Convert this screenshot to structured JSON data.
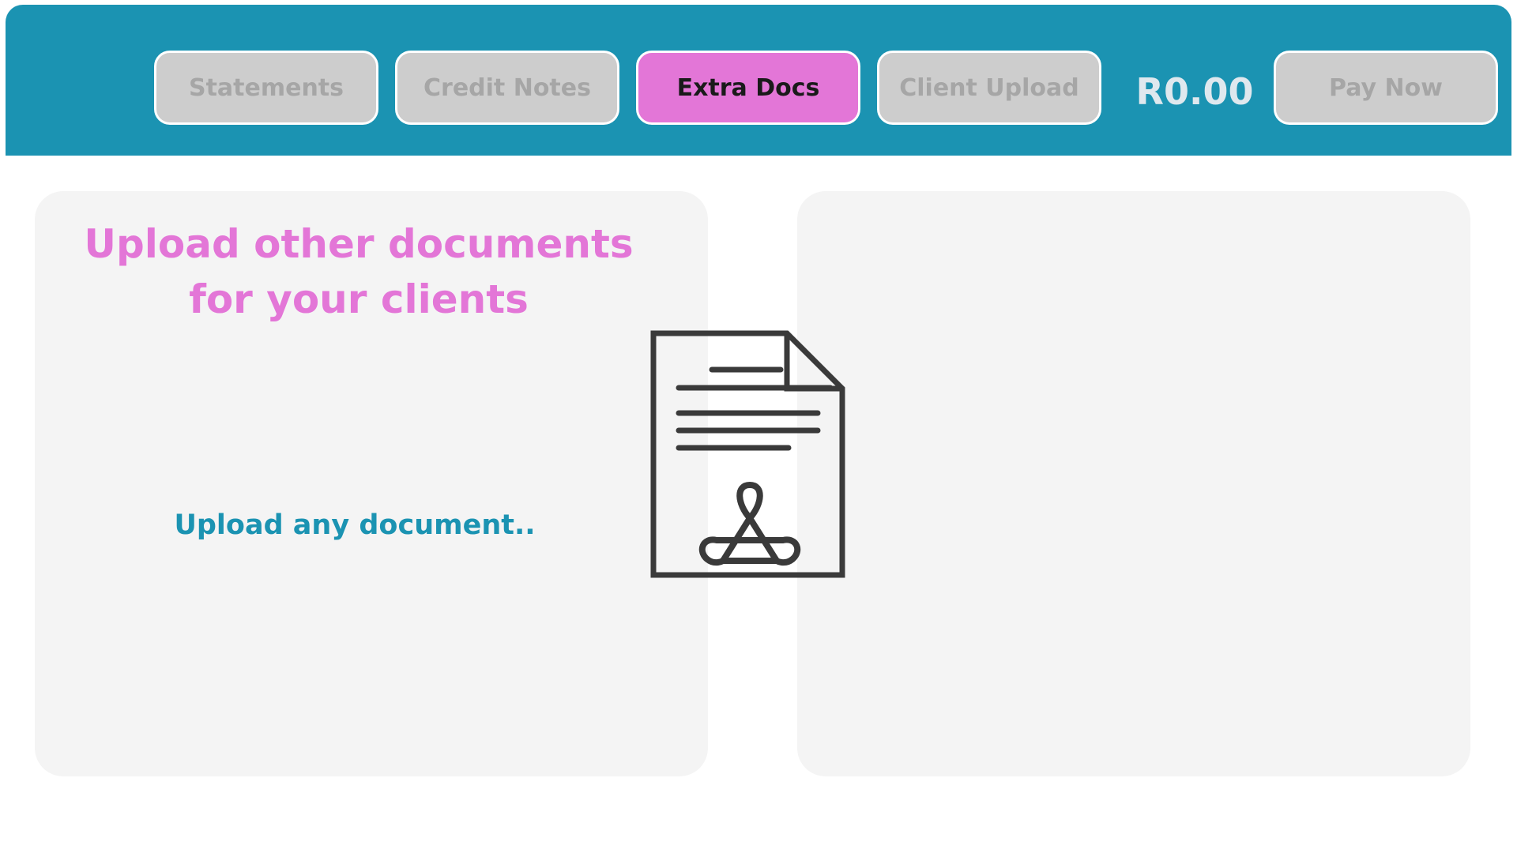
{
  "header": {
    "tabs": [
      {
        "label": "Statements",
        "active": false
      },
      {
        "label": "Credit Notes",
        "active": false
      },
      {
        "label": "Extra Docs",
        "active": true
      },
      {
        "label": "Client Upload",
        "active": false
      }
    ],
    "balance": "R0.00",
    "pay_now_label": "Pay Now"
  },
  "left_panel": {
    "headline_line1": "Upload other documents",
    "headline_line2": "for your clients",
    "subtext": "Upload any document.."
  },
  "icons": {
    "document": "pdf-document-icon"
  },
  "colors": {
    "header_bg": "#1b93b2",
    "accent_pink": "#e376d7",
    "inactive_button": "#cdcdcd",
    "inactive_text": "#a6a6a6",
    "panel_bg": "#f4f4f4",
    "icon_stroke": "#3a3a3a"
  }
}
